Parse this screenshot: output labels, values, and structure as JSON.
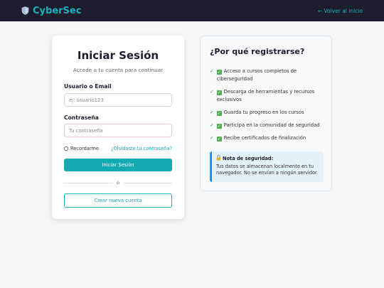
{
  "header": {
    "brand": "CyberSec",
    "back_link": "← Volver al inicio"
  },
  "login": {
    "title": "Iniciar Sesión",
    "subtitle": "Accede a tu cuenta para continuar",
    "username_label": "Usuario o Email",
    "username_placeholder": "ej: usuario123",
    "password_label": "Contraseña",
    "password_placeholder": "Tu contraseña",
    "remember_label": "Recordarme",
    "forgot_link": "¿Olvidaste tu contraseña?",
    "submit_button": "Iniciar Sesión",
    "divider": "o",
    "create_account_button": "Crear nueva cuenta"
  },
  "info": {
    "title": "¿Por qué registrarse?",
    "benefits": [
      "Acceso a cursos completos de ciberseguridad",
      "Descarga de herramientas y recursos exclusivos",
      "Guarda tu progreso en los cursos",
      "Participa en la comunidad de seguridad",
      "Recibe certificados de finalización"
    ],
    "note_title": "Nota de seguridad:",
    "note_text": "Tus datos se almacenan localmente en tu navegador. No se envían a ningún servidor."
  },
  "colors": {
    "header_bg": "#1d1d2e",
    "accent": "#13aab2",
    "check": "#4caf50",
    "note_bg": "#e3f1fb",
    "note_border": "#2d8fe0"
  },
  "icons": [
    "shield-icon",
    "check-icon",
    "lock-icon"
  ]
}
